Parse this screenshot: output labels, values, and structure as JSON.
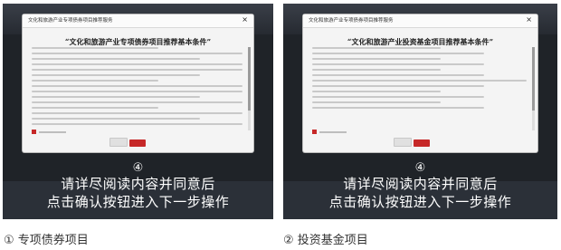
{
  "panels": [
    {
      "dialog_title": "文化和旅游产业专项债券项目推荐服务",
      "doc_title": "“文化和旅游产业专项债券项目推荐基本条件”",
      "step_marker": "④",
      "instruction_line1": "请详尽阅读内容并同意后",
      "instruction_line2": "点击确认按钮进入下一步操作",
      "caption": "① 专项债券项目"
    },
    {
      "dialog_title": "文化和旅游产业专项债券项目推荐服务",
      "doc_title": "“文化和旅游产业投资基金项目推荐基本条件”",
      "step_marker": "④",
      "instruction_line1": "请详尽阅读内容并同意后",
      "instruction_line2": "点击确认按钮进入下一步操作",
      "caption": "② 投资基金项目"
    }
  ],
  "close_glyph": "×",
  "accent_color": "#c62828"
}
